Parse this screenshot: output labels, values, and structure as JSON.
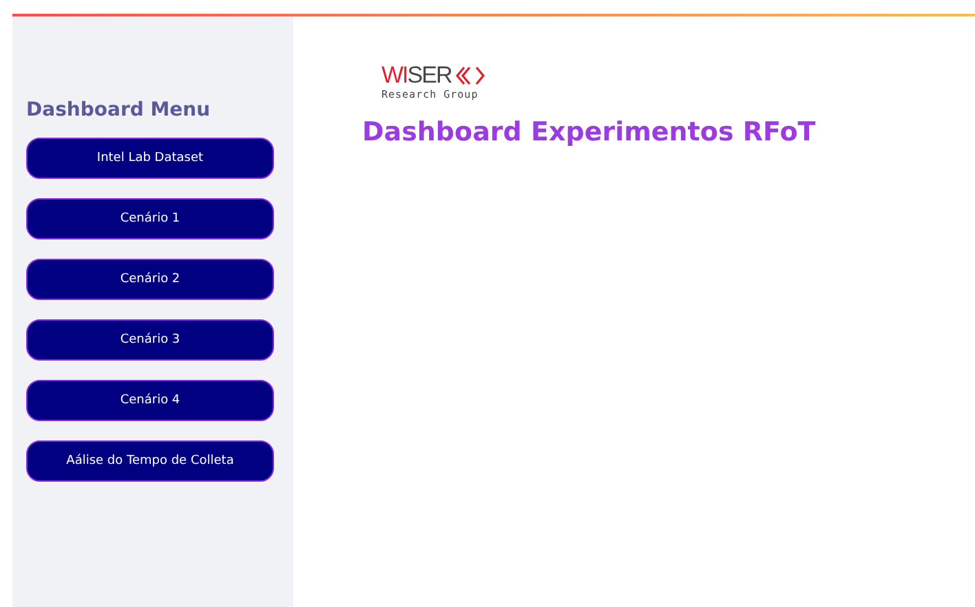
{
  "sidebar": {
    "title": "Dashboard Menu",
    "items": [
      {
        "label": "Intel Lab Dataset"
      },
      {
        "label": "Cenário 1"
      },
      {
        "label": "Cenário 2"
      },
      {
        "label": "Cenário 3"
      },
      {
        "label": "Cenário 4"
      },
      {
        "label": "Aálise do Tempo de Colleta"
      }
    ]
  },
  "logo": {
    "name": "WISER",
    "subtitle": "Research Group"
  },
  "main": {
    "title": "Dashboard Experimentos RFoT"
  }
}
